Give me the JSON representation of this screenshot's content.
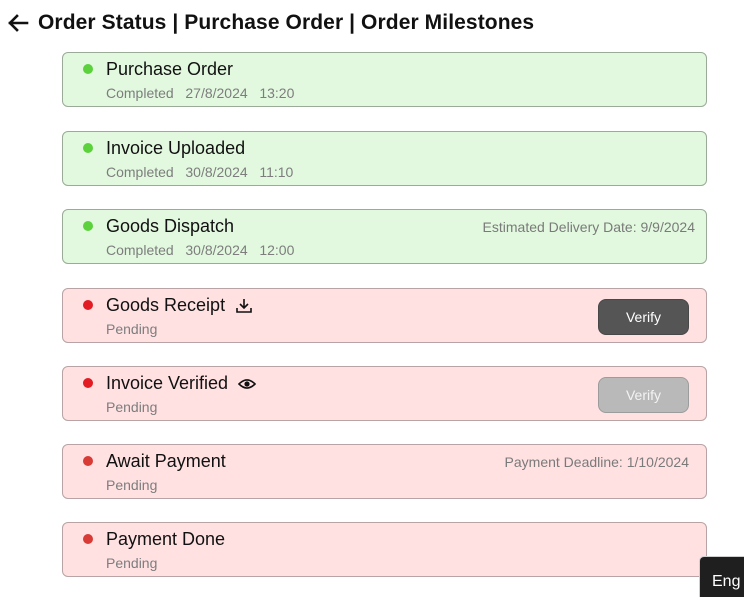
{
  "header": {
    "back_icon": "arrow-left-icon",
    "title": "Order Status | Purchase Order | Order Milestones"
  },
  "colors": {
    "completed_bg": "#e2f9df",
    "pending_bg": "#ffe1e2",
    "completed_dot": "#5bd13c",
    "pending_dot": "#e21c22",
    "verify_active": "#555555",
    "verify_disabled": "#b9b9b9"
  },
  "milestones": [
    {
      "title": "Purchase Order",
      "status": "Completed",
      "date": "27/8/2024",
      "time": "13:20"
    },
    {
      "title": "Invoice Uploaded",
      "status": "Completed",
      "date": "30/8/2024",
      "time": "11:10"
    },
    {
      "title": "Goods Dispatch",
      "status": "Completed",
      "date": "30/8/2024",
      "time": "12:00",
      "right_text": "Estimated Delivery Date: 9/9/2024"
    },
    {
      "title": "Goods Receipt",
      "status": "Pending",
      "icon": "download-icon",
      "button_label": "Verify",
      "button_state": "enabled"
    },
    {
      "title": "Invoice Verified",
      "status": "Pending",
      "icon": "eye-icon",
      "button_label": "Verify",
      "button_state": "disabled"
    },
    {
      "title": "Await Payment",
      "status": "Pending",
      "right_text": "Payment Deadline: 1/10/2024"
    },
    {
      "title": "Payment Done",
      "status": "Pending"
    }
  ],
  "language_tab": {
    "label": "Eng"
  }
}
